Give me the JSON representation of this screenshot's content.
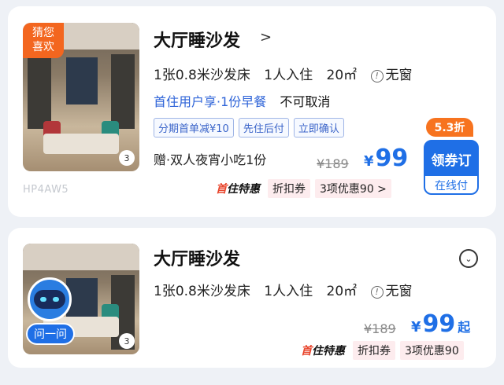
{
  "cards": [
    {
      "badge": "猜您喜欢",
      "badge_line1": "猜您",
      "badge_line2": "喜欢",
      "photo_count": "3",
      "watermark": "HP4AW5",
      "title": "大厅睡沙发",
      "chevron": ">",
      "bed": "1张0.8米沙发床",
      "occupancy": "1人入住",
      "area": "20㎡",
      "window_icon": "!",
      "window": "无窗",
      "perk": "首住用户享·1份早餐",
      "cancel": "不可取消",
      "chips": [
        "分期首单减¥10",
        "先住后付",
        "立即确认"
      ],
      "gift": "赠·双人夜宵小吃1份",
      "original_price": "¥189",
      "currency": "¥",
      "price": "99",
      "discount": "5.3折",
      "book_label": "领券订",
      "book_sub": "在线付",
      "promo_brand_a": "首",
      "promo_brand_b": "住特惠",
      "promo_coupon": "折扣券",
      "promo_deals": "3项优惠90 >"
    },
    {
      "photo_count": "3",
      "ask_label": "问一问",
      "title": "大厅睡沙发",
      "chevron": "⌄",
      "bed": "1张0.8米沙发床",
      "occupancy": "1人入住",
      "area": "20㎡",
      "window_icon": "!",
      "window": "无窗",
      "original_price": "¥189",
      "currency": "¥",
      "price": "99",
      "price_suffix": "起",
      "promo_brand_a": "首",
      "promo_brand_b": "住特惠",
      "promo_coupon": "折扣券",
      "promo_deals": "3项优惠90"
    }
  ],
  "colors": {
    "accent": "#1f6fe6",
    "orange": "#f3661f",
    "perk_blue": "#2d63d8"
  }
}
